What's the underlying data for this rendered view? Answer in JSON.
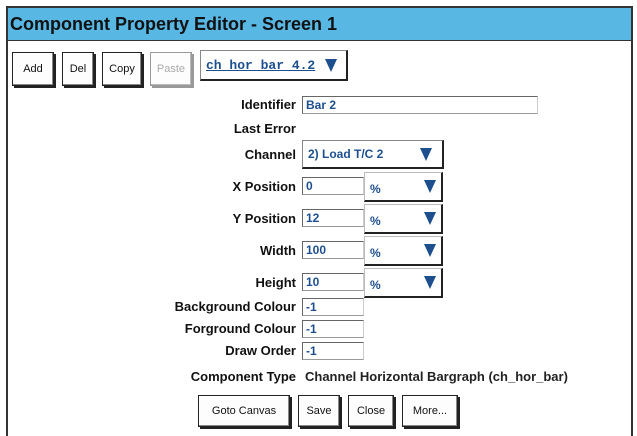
{
  "window": {
    "title": "Component Property Editor - Screen 1"
  },
  "toolbar": {
    "add_label": "Add",
    "del_label": "Del",
    "copy_label": "Copy",
    "paste_label": "Paste",
    "component_select_value": "ch_hor_bar_4.2"
  },
  "form": {
    "identifier": {
      "label": "Identifier",
      "value": "Bar 2"
    },
    "last_error": {
      "label": "Last Error",
      "value": ""
    },
    "channel": {
      "label": "Channel",
      "value": "2) Load T/C 2"
    },
    "x_position": {
      "label": "X Position",
      "value": "0",
      "unit": "%"
    },
    "y_position": {
      "label": "Y Position",
      "value": "12",
      "unit": "%"
    },
    "width": {
      "label": "Width",
      "value": "100",
      "unit": "%"
    },
    "height": {
      "label": "Height",
      "value": "10",
      "unit": "%"
    },
    "background_colour": {
      "label": "Background Colour",
      "value": "-1"
    },
    "forground_colour": {
      "label": "Forground Colour",
      "value": "-1"
    },
    "draw_order": {
      "label": "Draw Order",
      "value": "-1"
    },
    "component_type": {
      "label": "Component Type",
      "value": "Channel Horizontal Bargraph (ch_hor_bar)"
    }
  },
  "footer": {
    "goto_canvas_label": "Goto Canvas",
    "save_label": "Save",
    "close_label": "Close",
    "more_label": "More..."
  },
  "colors": {
    "titlebar": "#58b7e3",
    "value_text": "#1d4f8f"
  }
}
